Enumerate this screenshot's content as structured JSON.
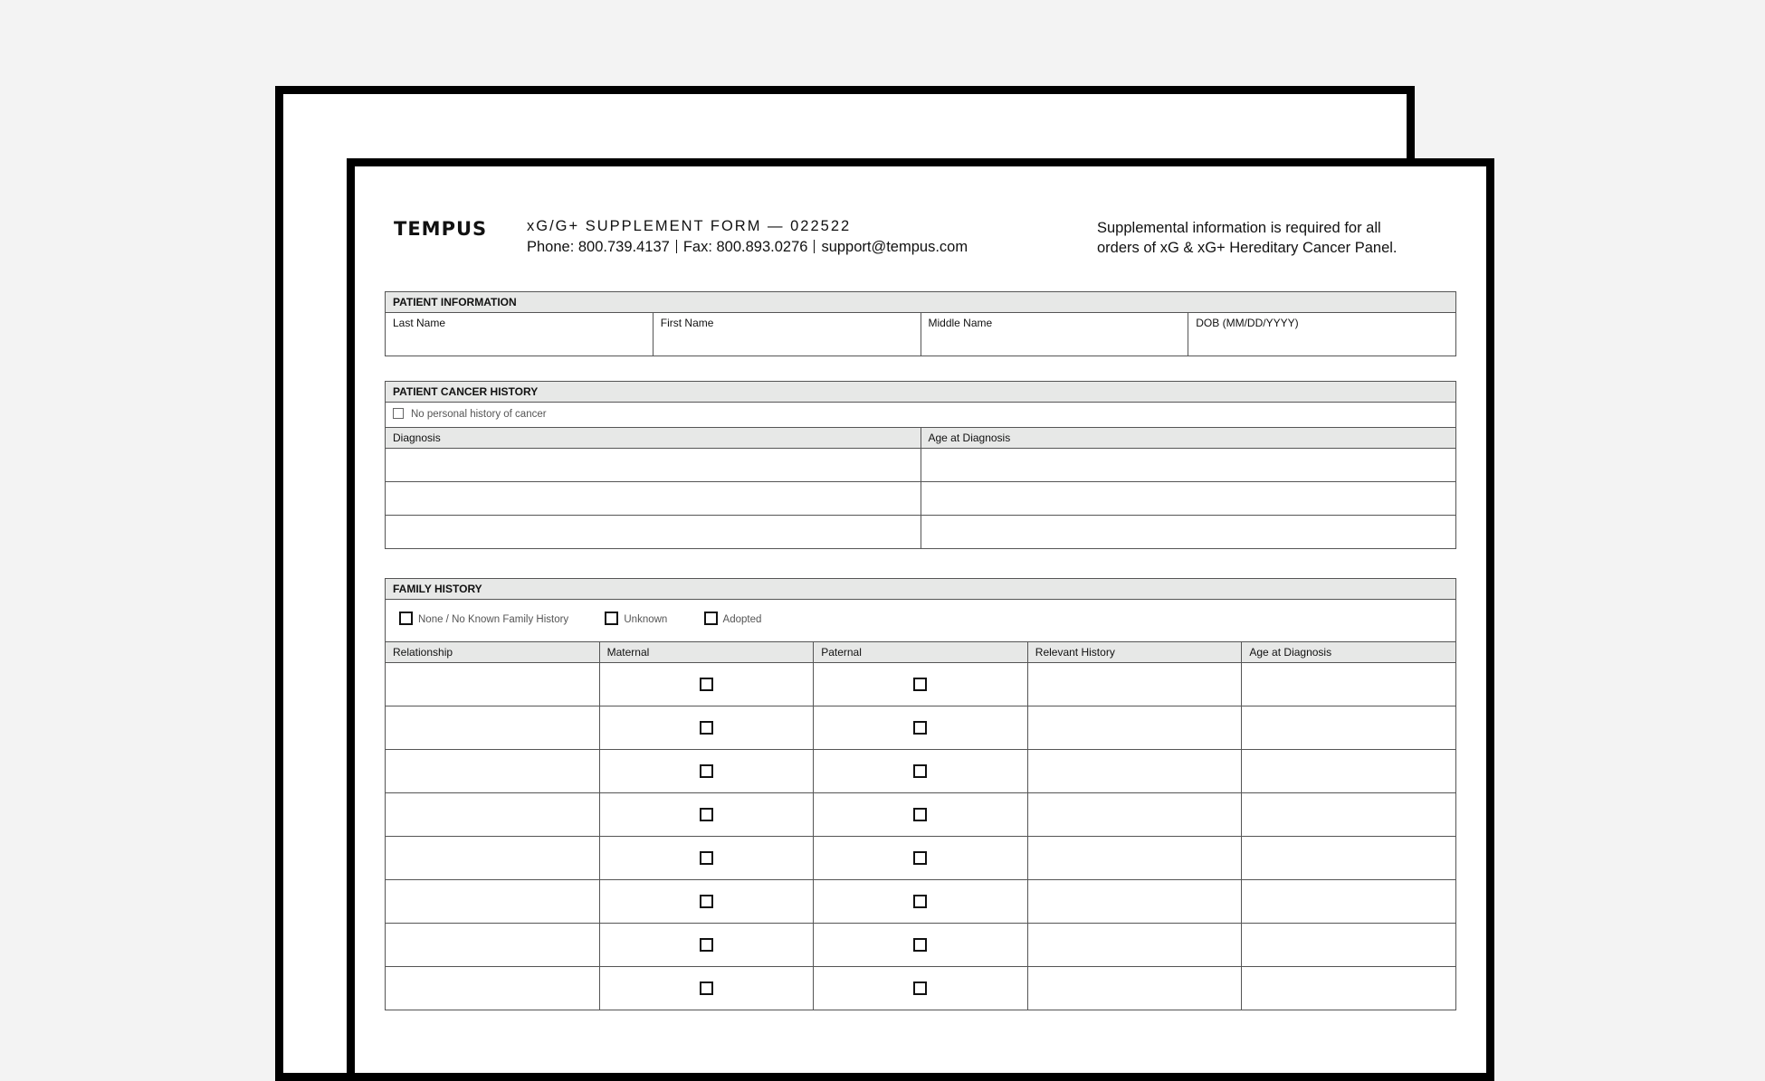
{
  "header": {
    "logo": "TEMPUS",
    "form_title": "xG/G+ SUPPLEMENT FORM — 022522",
    "phone": "Phone: 800.739.4137",
    "fax": "Fax: 800.893.0276",
    "email": "support@tempus.com",
    "note": "Supplemental information is required for all orders of xG & xG+ Hereditary Cancer Panel."
  },
  "patient_info": {
    "title": "PATIENT INFORMATION",
    "fields": [
      "Last Name",
      "First Name",
      "Middle Name",
      "DOB (MM/DD/YYYY)"
    ]
  },
  "cancer_history": {
    "title": "PATIENT CANCER HISTORY",
    "no_history_label": "No personal history of cancer",
    "col_diagnosis": "Diagnosis",
    "col_age": "Age at Diagnosis"
  },
  "family_history": {
    "title": "FAMILY HISTORY",
    "options": [
      "None / No Known Family History",
      "Unknown",
      "Adopted"
    ],
    "col_relationship": "Relationship",
    "col_maternal": "Maternal",
    "col_paternal": "Paternal",
    "col_relevant": "Relevant History",
    "col_age": "Age at Diagnosis"
  }
}
